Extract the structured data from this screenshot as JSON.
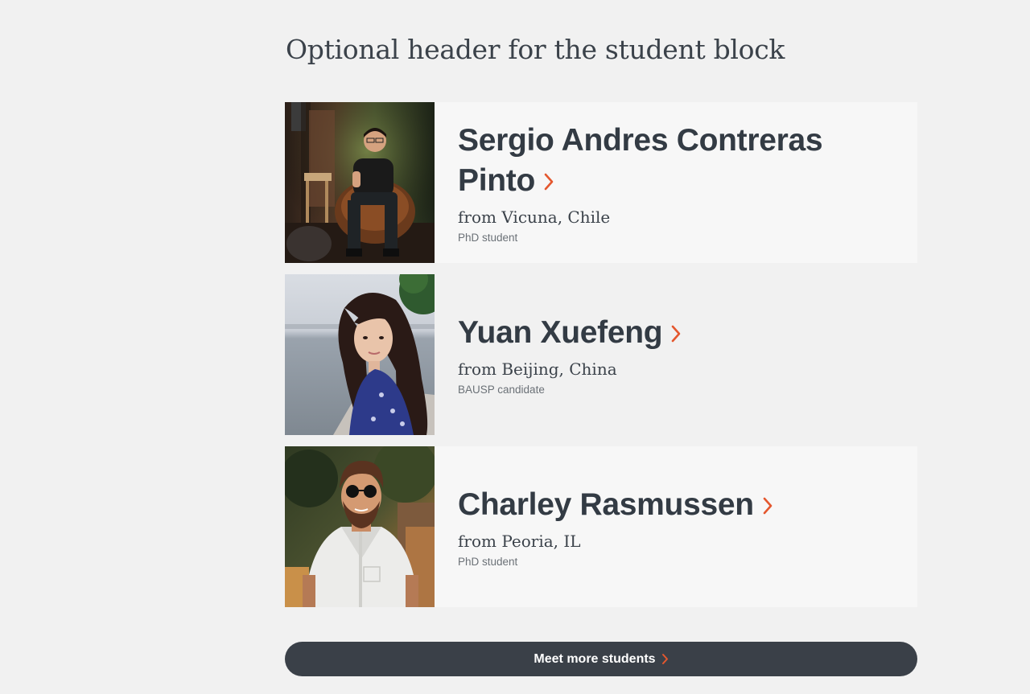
{
  "header": {
    "title": "Optional header for the student block"
  },
  "students": [
    {
      "name_line1": "Sergio Andres Contreras",
      "name_line2": "Pinto",
      "origin": "from Vicuna, Chile",
      "role": "PhD student"
    },
    {
      "name": "Yuan Xuefeng",
      "origin": "from Beijing, China",
      "role": "BAUSP candidate"
    },
    {
      "name": "Charley Rasmussen",
      "origin": "from Peoria, IL",
      "role": "PhD student"
    }
  ],
  "more_button": {
    "label": "Meet more students"
  },
  "colors": {
    "accent": "#e4572e",
    "text_dark": "#333b44",
    "button_bg": "#3a4048",
    "page_bg": "#f1f1f1"
  },
  "icons": {
    "card_link": "chevron-right-icon",
    "button_link": "chevron-right-icon"
  }
}
